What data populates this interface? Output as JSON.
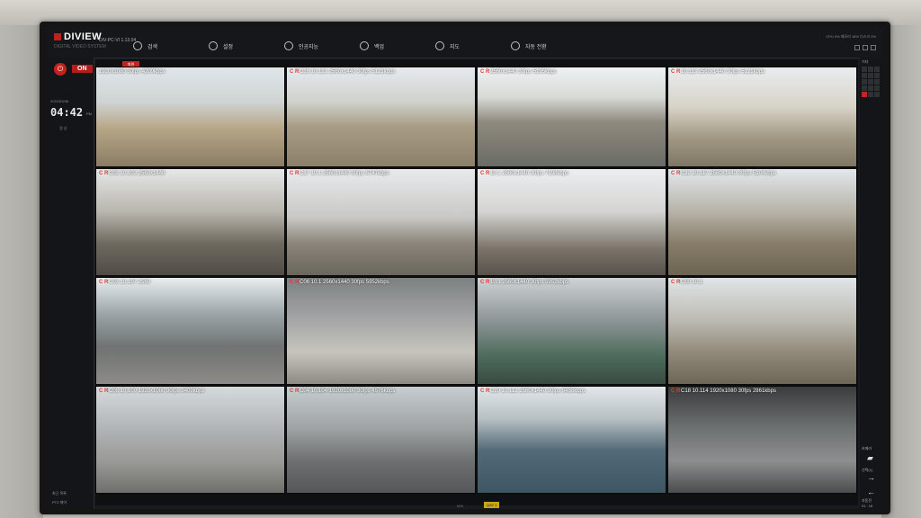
{
  "app": {
    "logo": "DIVIEW",
    "logo_sub": "DIGITAL VIDEO SYSTEM",
    "version": "DIV-PC-VI 1.13.04",
    "topright": "CPU 0% 메모리 18% 디스크 2%"
  },
  "menu": [
    {
      "label": "검색",
      "icon": "search-icon"
    },
    {
      "label": "설정",
      "icon": "gear-icon"
    },
    {
      "label": "인공지능",
      "icon": "ai-icon"
    },
    {
      "label": "백업",
      "icon": "backup-icon"
    },
    {
      "label": "지도",
      "icon": "map-pin-icon"
    },
    {
      "label": "자동 전환",
      "icon": "auto-switch-icon"
    }
  ],
  "left": {
    "on_label": "ON",
    "date": "2022/03/08",
    "time": "04:42",
    "ampm": "PM",
    "status": "정 상",
    "bottom1": "최근 목록",
    "bottom2": "PTZ 제어"
  },
  "view_tab": "화면",
  "cameras": [
    {
      "rec": "",
      "caption": "1920x1080 30fps 4209kbps",
      "scene": "industrial-yard-tanks"
    },
    {
      "rec": "C R",
      "caption": "C16  10.121  2560x1440  30fps  5121kbps",
      "scene": "road-with-shrubs"
    },
    {
      "rec": "C R",
      "caption": "2560x1440  30fps  5195kbps",
      "scene": "roadside-fence"
    },
    {
      "rec": "C R",
      "caption": "10.113  2560x1440  30fps  5121kbps",
      "scene": "tank-with-stairs"
    },
    {
      "rec": "C R",
      "caption": "C02  10.102  2560x1440",
      "scene": "pump-area"
    },
    {
      "rec": "C R",
      "caption": "C17  10.1  2560x1440  30fps  5747kbps",
      "scene": "tank-platform"
    },
    {
      "rec": "C R",
      "caption": "10.1  2560x1440  30fps  7198kbps",
      "scene": "tank-pipes"
    },
    {
      "rec": "C R",
      "caption": "C12  10.117  2560x1440  30fps  5104kbps",
      "scene": "highway-side"
    },
    {
      "rec": "C R",
      "caption": "C03  10.107  2560",
      "scene": "tanker-truck"
    },
    {
      "rec": "C R",
      "caption": "C06  10.1  2560x1440  30fps  5952kbps",
      "scene": "office-lobby"
    },
    {
      "rec": "C R",
      "caption": "10.1  2560x1440  30fps  5952kbps",
      "scene": "pump-room"
    },
    {
      "rec": "C R",
      "caption": "C09  10.1",
      "scene": "pipeline-fence"
    },
    {
      "rec": "C R",
      "caption": "C05  10.109  1920x1080  30fps  3409kbps",
      "scene": "truck-gate"
    },
    {
      "rec": "C R",
      "caption": "C04  10.104  1920x1080  30fps  4576kbps",
      "scene": "parking-lot"
    },
    {
      "rec": "C R",
      "caption": "C20  10.112  2560x1440  30fps  5456kbps",
      "scene": "pier-sea"
    },
    {
      "rec": "C R",
      "caption": "C18  10.114  1920x1080  30fps  2861kbps",
      "scene": "pipes-night"
    }
  ],
  "right": {
    "label": "기타",
    "ctrl1": "카메라",
    "ctrl2": "선택(1)",
    "ctrl3": "자동전",
    "page": "01 : 16"
  },
  "chin": {
    "brand": "MSI",
    "sticker": "QAY 1"
  }
}
